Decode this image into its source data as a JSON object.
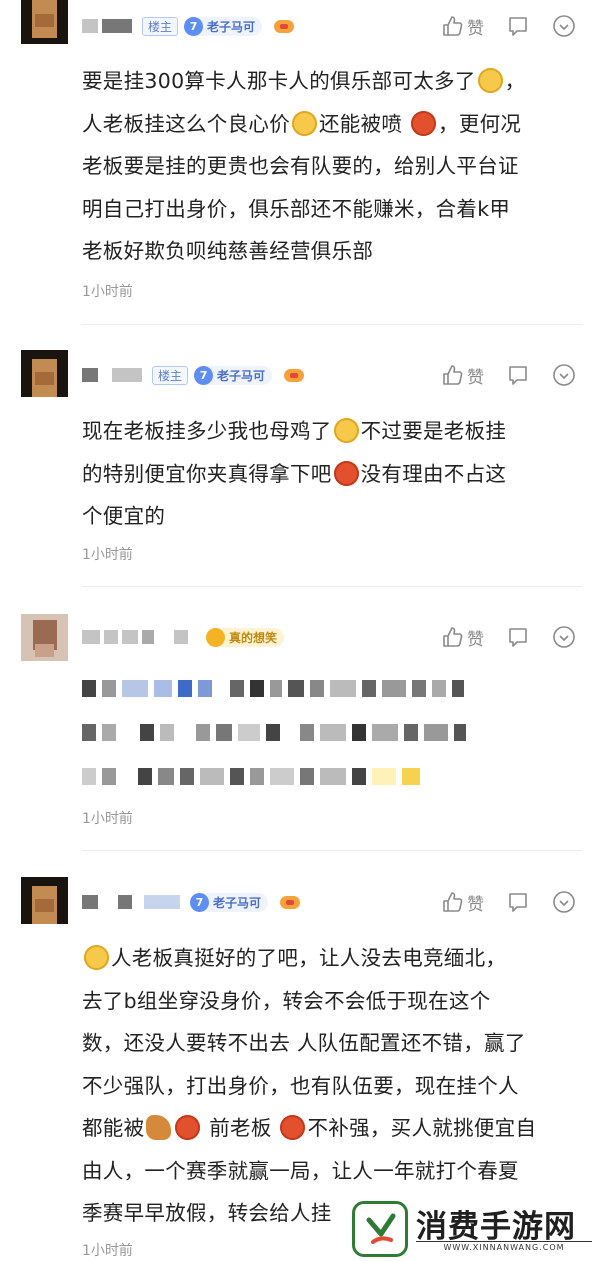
{
  "comments": [
    {
      "host_badge": "楼主",
      "level": "7",
      "title_badge": "老子马可",
      "actions": {
        "like": "赞"
      },
      "text_lines": [
        "要是挂300算卡人那卡人的俱乐部可太多了",
        "人老板挂这么个良心价",
        "还能被喷",
        "，更何况",
        "老板要是挂的更贵也会有队要的，给别人平台证",
        "明自己打出身价，俱乐部还不能赚米，合着k甲",
        "老板好欺负呗纯慈善经营俱乐部"
      ],
      "time": "1小时前"
    },
    {
      "host_badge": "楼主",
      "level": "7",
      "title_badge": "老子马可",
      "actions": {
        "like": "赞"
      },
      "text_lines": [
        "现在老板挂多少我也母鸡了",
        "不过要是老板挂",
        "的特别便宜你夹真得拿下吧",
        "没有理由不占这",
        "个便宜的"
      ],
      "time": "1小时前"
    },
    {
      "title_badge": "真的想笑",
      "actions": {
        "like": "赞"
      },
      "time": "1小时前"
    },
    {
      "level": "7",
      "title_badge": "老子马可",
      "actions": {
        "like": "赞"
      },
      "text_lines": [
        "人老板真挺好的了吧，让人没去电竞缅北，",
        "去了b组坐穿没身价，转会不会低于现在这个",
        "数，还没人要转不出去 人队伍配置还不错，赢了",
        "不少强队，打出身价，也有队伍要，现在挂个人",
        "都能被",
        "前老板",
        "不补强，买人就挑便宜自",
        "由人，一个赛季就赢一局，让人一年就打个春夏",
        "季赛早早放假，转会给人挂"
      ],
      "time": "1小时前"
    }
  ],
  "watermark": {
    "title": "消费手游网",
    "url": "WWW.XINNANWANG.COM"
  },
  "colors": {
    "accent": "#5f8ef2",
    "gold": "#f3b324",
    "text": "#222222",
    "meta": "#999999"
  },
  "icons": [
    "like-icon",
    "reply-icon",
    "more-icon",
    "game-controller-icon",
    "emoji-icon"
  ]
}
